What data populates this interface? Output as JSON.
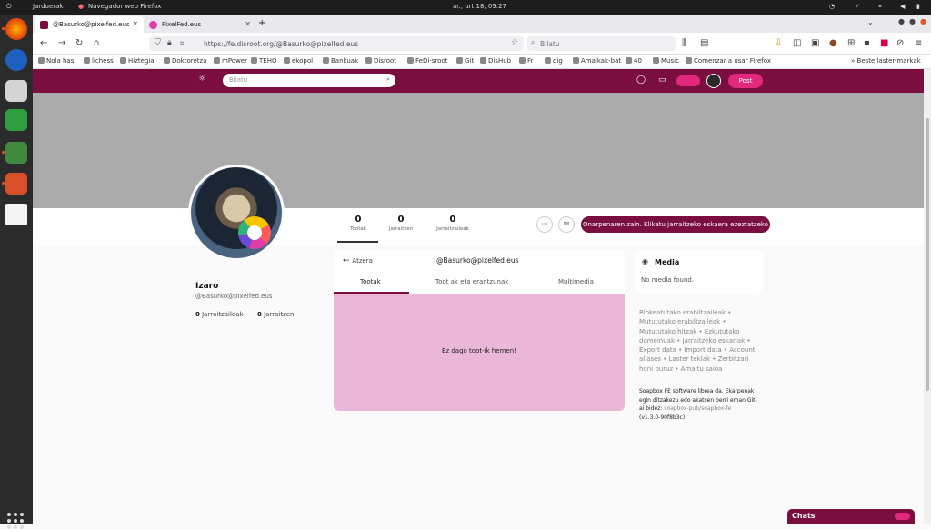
{
  "os": {
    "activities": "Jarduerak",
    "app_menu": "Navegador web Firefox",
    "clock": "ar., urt 18, 09:27"
  },
  "browser": {
    "tabs": [
      {
        "label": "@Basurko@pixelfed.eus"
      },
      {
        "label": "PixelFed.eus"
      }
    ],
    "new_tab": "+",
    "url": "https://fe.disroot.org/@Basurko@pixelfed.eus",
    "search_placeholder": "Bilatu",
    "bookmarks": [
      "Nola hasi",
      "lichess",
      "Hiztegia",
      "Doktoretza",
      "mPower",
      "TEHO",
      "ekopol",
      "Bankuak",
      "Disroot",
      "FeDi-sroot",
      "Git",
      "DisHub",
      "Fr",
      "dig",
      "Amaikak-bat",
      "40",
      "Music",
      "Comenzar a usar Firefox"
    ],
    "other_bookmarks": "Beste laster-markak"
  },
  "app": {
    "search_placeholder": "Bilatu",
    "post_label": "Post",
    "accent": "#7a0e3e",
    "accent_bright": "#e0297c"
  },
  "profile": {
    "stats": [
      {
        "count": "0",
        "label": "Tootak"
      },
      {
        "count": "0",
        "label": "Jarraitzen"
      },
      {
        "count": "0",
        "label": "Jarraitzaileak"
      }
    ],
    "follow_button": "Onarpenaren zain. Klikatu jarraitzeko eskaera ezeztatzeko",
    "name": "Izaro",
    "handle": "@Basurko@pixelfed.eus",
    "followers_count": "0",
    "followers_label": "Jarraitzaileak",
    "following_count": "0",
    "following_label": "Jarraitzen"
  },
  "timeline": {
    "back_label": "Atzera",
    "title": "@Basurko@pixelfed.eus",
    "tabs": [
      "Tootak",
      "Toot ak eta erantzunak",
      "Multimedia"
    ],
    "empty_message": "Ez dago toot-ik hemen!"
  },
  "media_panel": {
    "title": "Media",
    "empty": "No media found."
  },
  "footer_links": "Blokeatutako erabiltzaileak • Mutututako erabiltzaileak • Mutututako hitzak • Ezkututako domeinuak • Jarraitzeko eskariak • Export data • Import data • Account aliases • Laster teklak • Zerbitzari honi buruz • Amaitu saioa",
  "credit": {
    "text": "Soapbox FE software librea da. Ekarpenak egin ditzakezu edo akatsen berri eman Git-ai bidez:",
    "repo": "soapbox-pub/soapbox-fe",
    "version": "(v1.3.0-90f8b3c)"
  },
  "chats": {
    "label": "Chats"
  }
}
